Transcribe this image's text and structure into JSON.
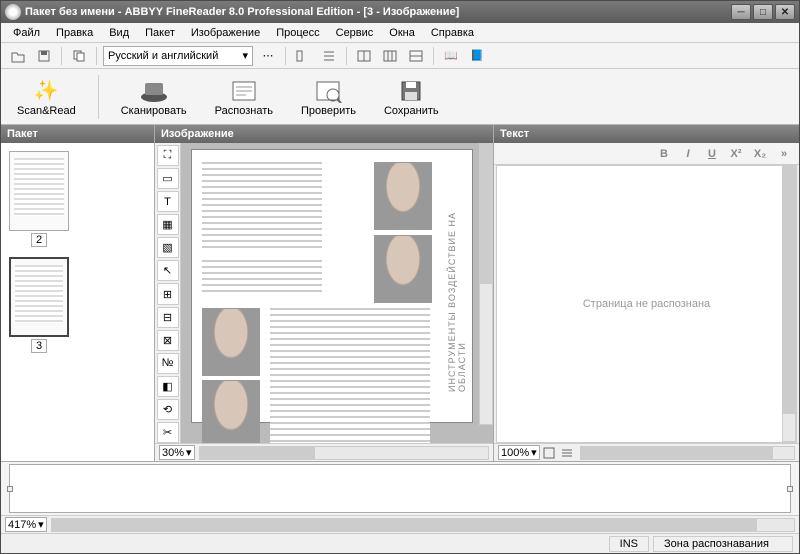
{
  "window": {
    "title": "Пакет без имени - ABBYY FineReader 8.0 Professional Edition - [3 - Изображение]"
  },
  "menu": {
    "file": "Файл",
    "edit": "Правка",
    "view": "Вид",
    "batch": "Пакет",
    "image": "Изображение",
    "process": "Процесс",
    "service": "Сервис",
    "windows": "Окна",
    "help": "Справка"
  },
  "language_selector": {
    "value": "Русский и английский"
  },
  "big_buttons": {
    "scan_read": "Scan&Read",
    "scan": "Сканировать",
    "recognize": "Распознать",
    "check": "Проверить",
    "save": "Сохранить"
  },
  "panels": {
    "batch": "Пакет",
    "image": "Изображение",
    "text": "Текст"
  },
  "thumbs": [
    {
      "num": "2"
    },
    {
      "num": "3"
    }
  ],
  "image_panel": {
    "zoom": "30%",
    "vertical_caption": "ИНСТРУМЕНТЫ   ВОЗДЕЙСТВИЕ НА ОБЛАСТИ"
  },
  "text_panel": {
    "zoom": "100%",
    "placeholder": "Страница не распознана"
  },
  "bottom_panel": {
    "zoom": "417%"
  },
  "status": {
    "ins": "INS",
    "zone": "Зона распознавания"
  }
}
